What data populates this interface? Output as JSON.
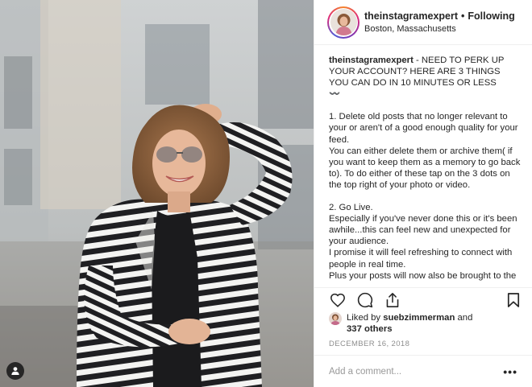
{
  "post": {
    "username": "theinstagramexpert",
    "follow_status": "Following",
    "location": "Boston, Massachusetts"
  },
  "caption": {
    "username": "theinstagramexpert",
    "lines": [
      " - NEED TO PERK UP YOUR ACCOUNT? HERE ARE 3 THINGS YOU CAN DO IN 10 MINUTES OR LESS",
      "〰️",
      "",
      "1. Delete old posts that no longer relevant to your or aren't of a good enough quality for your feed.",
      "You can either delete them or archive them( if you want to keep them as a memory to go back to). To do either of these tap on the 3 dots on the top right of your photo or video.",
      "",
      "2. Go Live.",
      "Especially if you've never done this or it's been awhile...this can feel new and unexpected for your audience.",
      "I promise it will feel refreshing to connect with people in real time.",
      "Plus your posts will now also be brought to the"
    ]
  },
  "likes": {
    "prefix": "Liked by ",
    "user": "suebzimmerman",
    "joiner": " and",
    "others": "337 others"
  },
  "date": "DECEMBER 16, 2018",
  "comment": {
    "placeholder": "Add a comment...",
    "more_label": "•••"
  },
  "icons": {
    "like": "heart-icon",
    "comment": "comment-icon",
    "share": "share-icon",
    "save": "bookmark-icon",
    "user_tag": "person-icon"
  },
  "colors": {
    "text": "#262626",
    "muted": "#8e8e8e",
    "border": "#efefef"
  }
}
